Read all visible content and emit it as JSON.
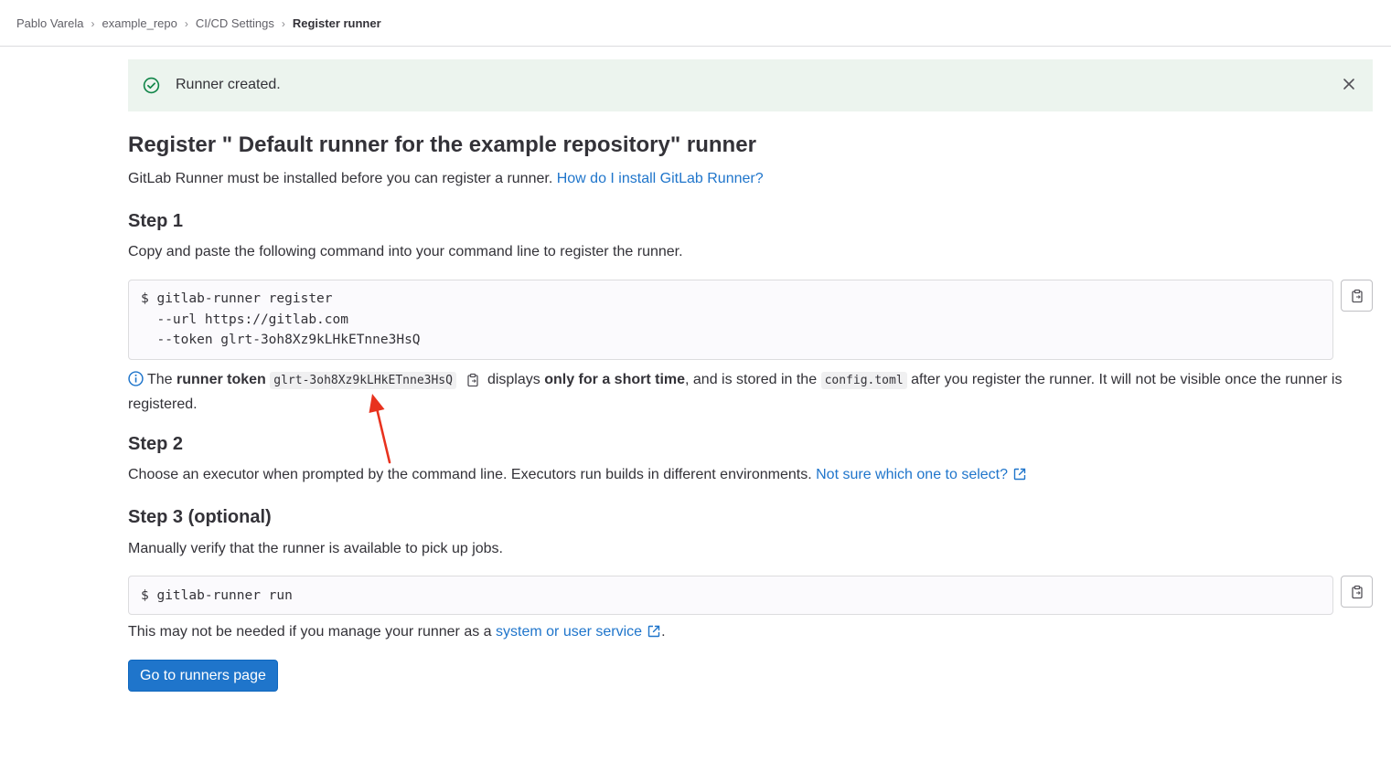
{
  "breadcrumb": {
    "items": [
      "Pablo Varela",
      "example_repo",
      "CI/CD Settings",
      "Register runner"
    ]
  },
  "alert": {
    "message": "Runner created.",
    "icon": "check-circle-icon",
    "close_icon": "close-icon"
  },
  "page": {
    "title": "Register \" Default runner for the example repository\" runner",
    "intro_text": "GitLab Runner must be installed before you can register a runner.",
    "intro_link": "How do I install GitLab Runner?"
  },
  "step1": {
    "heading": "Step 1",
    "description": "Copy and paste the following command into your command line to register the runner.",
    "command_lines": [
      "$ gitlab-runner register",
      "  --url https://gitlab.com",
      "  --token glrt-3oh8Xz9kLHkETnne3HsQ"
    ],
    "note": {
      "prefix": "The",
      "bold1": "runner token",
      "token": "glrt-3oh8Xz9kLHkETnne3HsQ",
      "mid1": "displays",
      "bold2": "only for a short time",
      "mid2": ", and is stored in the",
      "file": "config.toml",
      "suffix": "after you register the runner. It will not be visible once the runner is registered."
    }
  },
  "step2": {
    "heading": "Step 2",
    "description": "Choose an executor when prompted by the command line. Executors run builds in different environments.",
    "link": "Not sure which one to select?"
  },
  "step3": {
    "heading": "Step 3 (optional)",
    "description": "Manually verify that the runner is available to pick up jobs.",
    "command_lines": [
      "$ gitlab-runner run"
    ],
    "footer_prefix": "This may not be needed if you manage your runner as a",
    "footer_link": "system or user service",
    "footer_suffix": "."
  },
  "actions": {
    "primary": "Go to runners page"
  },
  "colors": {
    "link": "#1f75cb",
    "success_bg": "#ecf4ee",
    "success_icon": "#108548",
    "annotation_arrow": "#e8321e"
  }
}
